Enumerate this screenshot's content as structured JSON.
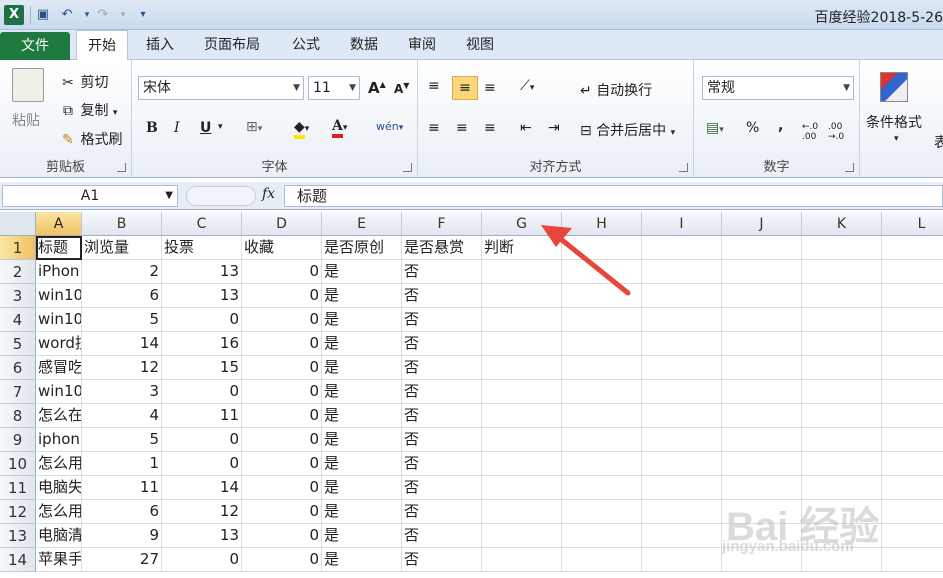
{
  "window": {
    "title": "百度经验2018-5-26",
    "app_icon": "X"
  },
  "quick_access": [
    "save-icon",
    "undo-icon",
    "redo-icon",
    "customize-icon"
  ],
  "tabs": [
    "文件",
    "开始",
    "插入",
    "页面布局",
    "公式",
    "数据",
    "审阅",
    "视图"
  ],
  "active_tab": "开始",
  "ribbon": {
    "clipboard": {
      "label": "剪贴板",
      "paste": "粘贴",
      "cut": "剪切",
      "copy": "复制",
      "format_painter": "格式刷"
    },
    "font": {
      "label": "字体",
      "name": "宋体",
      "size": "11",
      "bold": "B",
      "italic": "I",
      "underline": "U",
      "grow": "A",
      "shrink": "A",
      "font_color_letter": "A",
      "phonetic": "wén"
    },
    "alignment": {
      "label": "对齐方式",
      "wrap": "自动换行",
      "merge": "合并后居中"
    },
    "number": {
      "label": "数字",
      "format": "常规",
      "percent": "%",
      "comma": ","
    },
    "styles": {
      "conditional": "条件格式",
      "table_partial": "表"
    }
  },
  "formula_bar": {
    "name_box": "A1",
    "fx": "fx",
    "content": "标题"
  },
  "columns": [
    "A",
    "B",
    "C",
    "D",
    "E",
    "F",
    "G",
    "H",
    "I",
    "J",
    "K",
    "L"
  ],
  "rows": [
    {
      "n": "1",
      "cells": [
        "标题",
        "浏览量",
        "投票",
        "收藏",
        "是否原创",
        "是否悬赏",
        "判断"
      ]
    },
    {
      "n": "2",
      "cells": [
        "iPhon",
        "2",
        "13",
        "0",
        "是",
        "否",
        ""
      ]
    },
    {
      "n": "3",
      "cells": [
        "win10",
        "6",
        "13",
        "0",
        "是",
        "否",
        ""
      ]
    },
    {
      "n": "4",
      "cells": [
        "win10",
        "5",
        "0",
        "0",
        "是",
        "否",
        ""
      ]
    },
    {
      "n": "5",
      "cells": [
        "word技",
        "14",
        "16",
        "0",
        "是",
        "否",
        ""
      ]
    },
    {
      "n": "6",
      "cells": [
        "感冒吃",
        "12",
        "15",
        "0",
        "是",
        "否",
        ""
      ]
    },
    {
      "n": "7",
      "cells": [
        "win10",
        "3",
        "0",
        "0",
        "是",
        "否",
        ""
      ]
    },
    {
      "n": "8",
      "cells": [
        "怎么在",
        "4",
        "11",
        "0",
        "是",
        "否",
        ""
      ]
    },
    {
      "n": "9",
      "cells": [
        "iphon",
        "5",
        "0",
        "0",
        "是",
        "否",
        ""
      ]
    },
    {
      "n": "10",
      "cells": [
        "怎么用",
        "1",
        "0",
        "0",
        "是",
        "否",
        ""
      ]
    },
    {
      "n": "11",
      "cells": [
        "电脑失",
        "11",
        "14",
        "0",
        "是",
        "否",
        ""
      ]
    },
    {
      "n": "12",
      "cells": [
        "怎么用",
        "6",
        "12",
        "0",
        "是",
        "否",
        ""
      ]
    },
    {
      "n": "13",
      "cells": [
        "电脑清",
        "9",
        "13",
        "0",
        "是",
        "否",
        ""
      ]
    },
    {
      "n": "14",
      "cells": [
        "苹果手",
        "27",
        "0",
        "0",
        "是",
        "否",
        ""
      ]
    }
  ],
  "watermark": {
    "logo": "Bai 经验",
    "url": "jingyan.baidu.com"
  },
  "annotation": {
    "arrow_color": "#e8453c"
  }
}
